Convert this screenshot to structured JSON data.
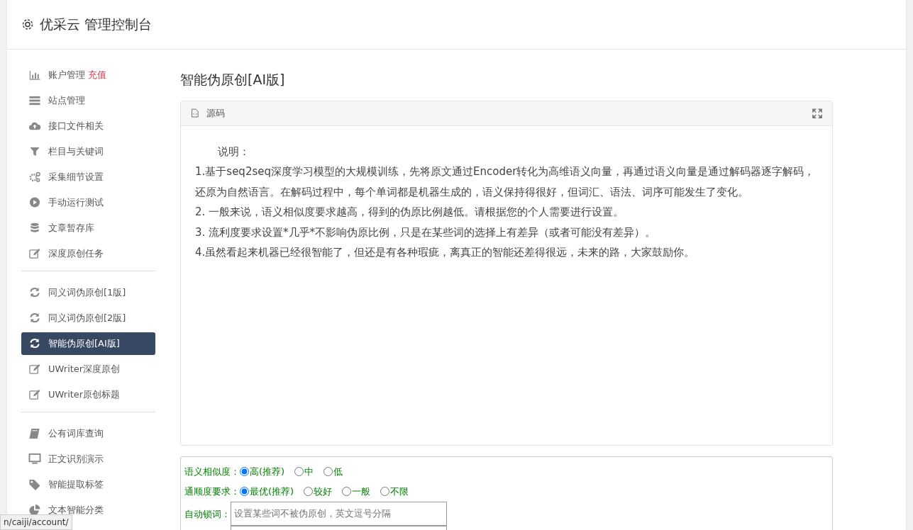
{
  "header": {
    "title": "优采云 管理控制台"
  },
  "sidebar": {
    "groups": [
      {
        "items": [
          {
            "label": "账户管理",
            "badge": "充值",
            "selected": false
          },
          {
            "label": "站点管理",
            "selected": false
          },
          {
            "label": "接口文件相关",
            "selected": false
          },
          {
            "label": "栏目与关键词",
            "selected": false
          },
          {
            "label": "采集细节设置",
            "selected": false
          },
          {
            "label": "手动运行测试",
            "selected": false
          },
          {
            "label": "文章暂存库",
            "selected": false
          },
          {
            "label": "深度原创任务",
            "selected": false
          }
        ]
      },
      {
        "items": [
          {
            "label": "同义词伪原创[1版]",
            "selected": false
          },
          {
            "label": "同义词伪原创[2版]",
            "selected": false
          },
          {
            "label": "智能伪原创[AI版]",
            "selected": true
          },
          {
            "label": "UWriter深度原创",
            "selected": false
          },
          {
            "label": "UWriter原创标题",
            "selected": false
          }
        ]
      },
      {
        "items": [
          {
            "label": "公有词库查询",
            "selected": false
          },
          {
            "label": "正文识别演示",
            "selected": false
          },
          {
            "label": "智能提取标签",
            "selected": false
          },
          {
            "label": "文本智能分类",
            "selected": false
          }
        ]
      }
    ]
  },
  "page_title": "智能伪原创[AI版]",
  "source_panel": {
    "label": "源码",
    "lines": [
      "说明：",
      "1.基于seq2seq深度学习模型的大规模训练，先将原文通过Encoder转化为高维语义向量，再通过语义向量是通过解码器逐字解码，还原为自然语言。在解码过程中，每个单词都是机器生成的，语义保持得很好，但词汇、语法、词序可能发生了变化。",
      "2. 一般来说，语义相似度要求越高，得到的伪原比例越低。请根据您的个人需要进行设置。",
      "3. 流利度要求设置*几乎*不影响伪原比例，只是在某些词的选择上有差异（或者可能没有差异）。",
      "4.虽然看起来机器已经很智能了，但还是有各种瑕疵，离真正的智能还差得很远，未来的路，大家鼓励你。"
    ]
  },
  "options": [
    {
      "label": "语义相似度：",
      "choices": [
        {
          "label": "高(推荐)",
          "selected": true
        },
        {
          "label": "中",
          "selected": false
        },
        {
          "label": "低",
          "selected": false
        }
      ]
    },
    {
      "label": "通顺度要求：",
      "choices": [
        {
          "label": "最优(推荐)",
          "selected": true
        },
        {
          "label": "较好",
          "selected": false
        },
        {
          "label": "一般",
          "selected": false
        },
        {
          "label": "不限",
          "selected": false
        }
      ]
    }
  ],
  "lock_words": {
    "label": "自动锁词：",
    "placeholder": "设置某些词不被伪原创，英文逗号分隔"
  },
  "status_url": "n/caiji/account/"
}
